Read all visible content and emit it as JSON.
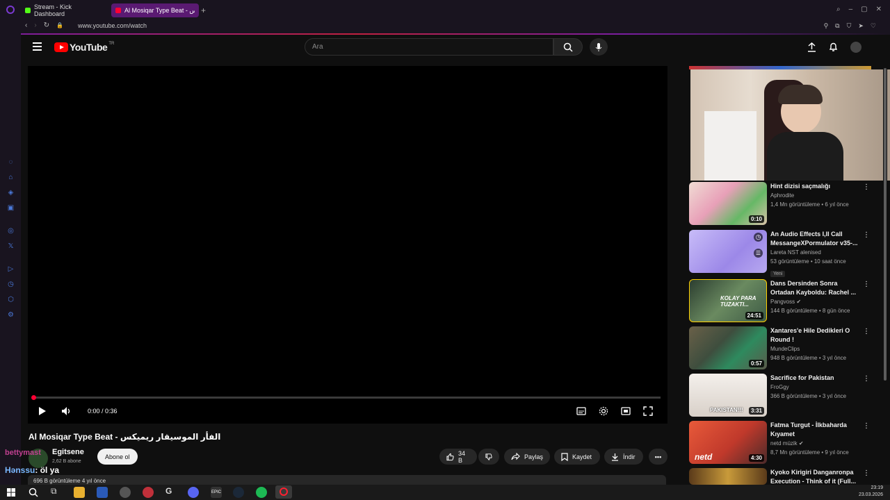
{
  "browser": {
    "tabs": [
      {
        "label": "Stream - Kick Dashboard",
        "color": "#53fc18"
      },
      {
        "label": "Al Mosiqar Type Beat - ريمكس",
        "color": "#ff0033"
      }
    ],
    "url": "www.youtube.com/watch"
  },
  "youtube": {
    "logo_text": "YouTube",
    "region": "TR",
    "search_placeholder": "Ara"
  },
  "player": {
    "time": "0:00 / 0:36"
  },
  "video": {
    "title": "Al Mosiqar Type Beat - الفأر الموسيقار ريميكس",
    "channel": "Egitsene",
    "subscribers": "2,62 B abone",
    "subscribe_label": "Abone ol",
    "likes": "34 B",
    "share_label": "Paylaş",
    "save_label": "Kaydet",
    "download_label": "İndir",
    "views_partial": "696 B görüntüleme  4 yıl önce"
  },
  "recommendations": [
    {
      "title": "Hint dizisi saçmalığı",
      "channel": "Aphrodite",
      "meta": "1,4 Mn görüntüleme • 6 yıl önce",
      "duration": "0:10",
      "thumb_color": "#e8cfc7"
    },
    {
      "title": "An Audio Effects I,II Call MessangeXPormulator v35-...",
      "channel": "Lareta NST alenised",
      "meta": "53 görüntüleme • 10 saat önce",
      "badge": "Yeni",
      "thumb_color": "#b7a8f0"
    },
    {
      "title": "Dans Dersinden Sonra Ortadan Kayboldu: Rachel ...",
      "channel": "Pangvoss",
      "meta": "144 B görüntüleme • 8 gün önce",
      "duration": "24:51",
      "thumb_color": "#3d5a45",
      "thumb_text": "KOLAY PARA TUZAKTI..."
    },
    {
      "title": "Xantares'e Hile Dedikleri O Round !",
      "channel": "MundeClips",
      "meta": "948 B görüntüleme • 3 yıl önce",
      "duration": "0:57",
      "thumb_color": "#4a5a4a"
    },
    {
      "title": "Sacrifice for Pakistan",
      "channel": "FroGgy",
      "meta": "366 B görüntüleme • 3 yıl önce",
      "duration": "3:31",
      "thumb_color": "#d8d4cf",
      "thumb_text": "PAKISTAN!!!"
    },
    {
      "title": "Fatma Turgut - İlkbaharda Kıyamet",
      "channel": "netd müzik",
      "meta": "8,7 Mn görüntüleme • 9 yıl önce",
      "duration": "4:30",
      "thumb_color": "#c0392b",
      "thumb_text": "netd"
    },
    {
      "title": "Kyoko Kirigiri Danganronpa Execution - Think of it (Full...",
      "channel": "",
      "meta": "",
      "thumb_color": "#8a6a2a"
    }
  ],
  "chat": [
    {
      "user": "bettymast",
      "text": ""
    },
    {
      "user": "Hənssu",
      "text": ": öl ya"
    }
  ],
  "taskbar": {
    "time": "23:19",
    "date": "23.03.2026"
  }
}
